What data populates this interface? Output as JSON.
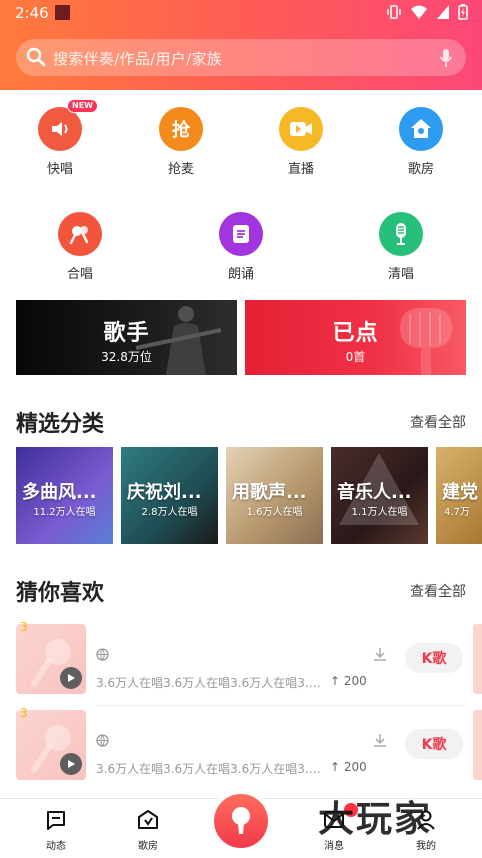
{
  "status_bar": {
    "time": "2:46"
  },
  "search": {
    "placeholder": "搜索伴奏/作品/用户/家族"
  },
  "features_row1": [
    {
      "label": "快唱",
      "icon": "fast-sing-icon",
      "color": "#f25a3f",
      "badge": "NEW"
    },
    {
      "label": "抢麦",
      "icon": "grab-mic-icon",
      "color": "#f58a1c"
    },
    {
      "label": "直播",
      "icon": "live-icon",
      "color": "#f7b826"
    },
    {
      "label": "歌房",
      "icon": "song-room-icon",
      "color": "#2d9cf0"
    }
  ],
  "features_row2": [
    {
      "label": "合唱",
      "icon": "chorus-icon",
      "color": "#f2543c"
    },
    {
      "label": "朗诵",
      "icon": "recite-icon",
      "color": "#a335e0"
    },
    {
      "label": "清唱",
      "icon": "acappella-icon",
      "color": "#26c07a"
    }
  ],
  "banners": [
    {
      "title": "歌手",
      "subtitle": "32.8万位"
    },
    {
      "title": "已点",
      "subtitle": "0首"
    }
  ],
  "featured": {
    "title": "精选分类",
    "see_all": "查看全部",
    "cards": [
      {
        "title": "多曲风...",
        "count": "11.2万人在唱",
        "color": "#5b48b8"
      },
      {
        "title": "庆祝刘...",
        "count": "2.8万人在唱",
        "color": "#2e6a70"
      },
      {
        "title": "用歌声...",
        "count": "1.6万人在唱",
        "color": "#c7b38e"
      },
      {
        "title": "音乐人...",
        "count": "1.1万人在唱",
        "color": "#3a2424"
      },
      {
        "title": "建党",
        "count": "4.7万",
        "color": "#c99a3c"
      }
    ]
  },
  "guess": {
    "title": "猜你喜欢",
    "see_all": "查看全部",
    "songs": [
      {
        "rank": "3",
        "desc": "3.6万人在唱3.6万人在唱3.6万人在唱3.6万人在唱",
        "count": "200",
        "button": "K歌"
      },
      {
        "rank": "3",
        "desc": "3.6万人在唱3.6万人在唱3.6万人在唱3.6万人在唱",
        "count": "200",
        "button": "K歌"
      }
    ]
  },
  "nav": {
    "items": [
      {
        "label": "动态",
        "icon": "feed-icon"
      },
      {
        "label": "歌房",
        "icon": "song-room-icon"
      },
      {
        "label": "消息",
        "icon": "message-icon"
      },
      {
        "label": "我的",
        "icon": "profile-icon"
      }
    ],
    "center_icon": "microphone-icon"
  },
  "watermark": "大玩家",
  "colors": {
    "accent": "#f0394a",
    "header_start": "#ff7a3c",
    "header_end": "#fc4877"
  }
}
